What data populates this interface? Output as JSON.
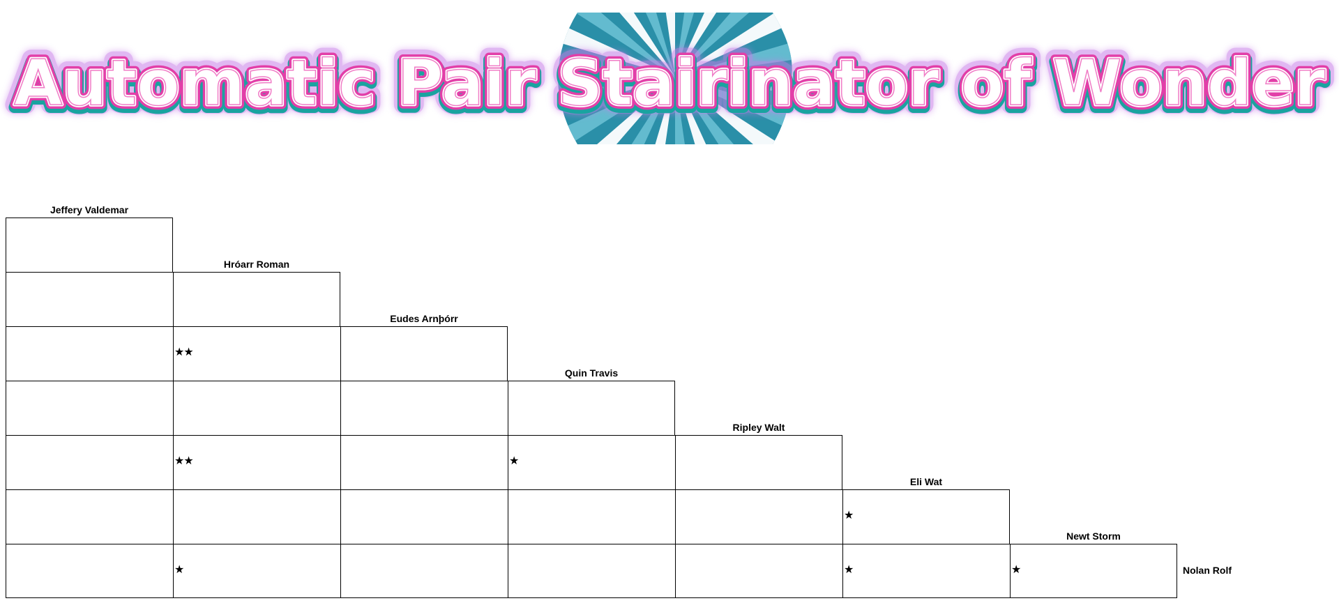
{
  "banner": {
    "title": "Automatic Pair Stairinator of Wonder"
  },
  "people": [
    "Jeffery Valdemar",
    "Hróarr Roman",
    "Eudes Arnþórr",
    "Quin Travis",
    "Ripley Walt",
    "Eli Wat",
    "Newt Storm"
  ],
  "last_row_label": "Nolan Rolf",
  "star_glyph": "★",
  "pair_counts": [
    [
      0
    ],
    [
      0,
      0
    ],
    [
      0,
      2,
      0
    ],
    [
      0,
      0,
      0,
      0
    ],
    [
      0,
      2,
      0,
      1,
      0
    ],
    [
      0,
      0,
      0,
      0,
      0,
      1
    ],
    [
      0,
      1,
      0,
      0,
      0,
      1,
      1
    ]
  ],
  "colors": {
    "burst_light": "#6ec3d9",
    "burst_dark": "#2a8fa8",
    "title_fill": "#ffffff",
    "title_outline_pink": "#e23fa8",
    "title_outline_teal": "#1aa3a0",
    "title_glow": "#c77ee8"
  }
}
